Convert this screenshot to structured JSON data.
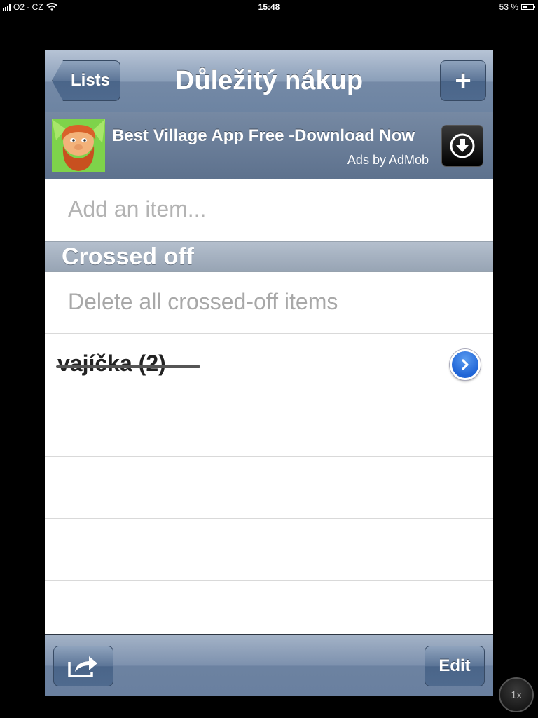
{
  "status_bar": {
    "carrier": "O2 - CZ",
    "time": "15:48",
    "battery_percent": "53 %",
    "battery_level": 0.53
  },
  "navbar": {
    "back_label": "Lists",
    "title": "Důležitý nákup",
    "add_label": "+"
  },
  "ad": {
    "title": "Best Village App Free -Download Now",
    "credit": "Ads by AdMob",
    "icon": "village-character-icon",
    "download_icon": "download-arrow-icon"
  },
  "list": {
    "add_placeholder": "Add an item...",
    "section_header": "Crossed off",
    "delete_all_label": "Delete all crossed-off items",
    "items": [
      {
        "label": "vajíčka (2)",
        "crossed_off": true
      }
    ]
  },
  "toolbar": {
    "share_icon": "share-arrow-icon",
    "edit_label": "Edit"
  },
  "zoom": {
    "label": "1x"
  },
  "colors": {
    "nav_blue": "#6d84a2",
    "disclosure_blue": "#1f64d6",
    "placeholder_gray": "#b3b3b3"
  }
}
